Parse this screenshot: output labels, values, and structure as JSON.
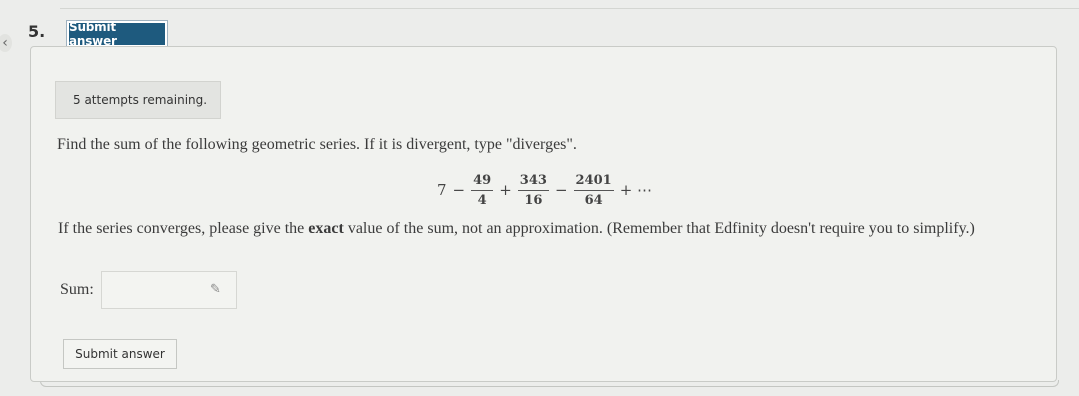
{
  "question": {
    "number": "5.",
    "top_button_label": "Submit answer",
    "attempts_text": "5 attempts remaining.",
    "prompt": "Find the sum of the following geometric series. If it is divergent, type \"diverges\".",
    "series": {
      "first_term": "7",
      "terms": [
        {
          "sign": "−",
          "numerator": "49",
          "denominator": "4"
        },
        {
          "sign": "+",
          "numerator": "343",
          "denominator": "16"
        },
        {
          "sign": "−",
          "numerator": "2401",
          "denominator": "64"
        }
      ],
      "tail": "+ ⋯"
    },
    "note_before": "If the series converges, please give the ",
    "note_bold": "exact",
    "note_after": " value of the sum, not an approximation. (Remember that Edfinity doesn't require you to simplify.)",
    "sum_label": "Sum:",
    "sum_value": "",
    "bottom_button_label": "Submit answer"
  },
  "icons": {
    "back": "chevron-left-icon",
    "edit": "pencil-icon"
  },
  "colors": {
    "primary_button": "#1e5a7e",
    "background": "#ecedeb"
  }
}
